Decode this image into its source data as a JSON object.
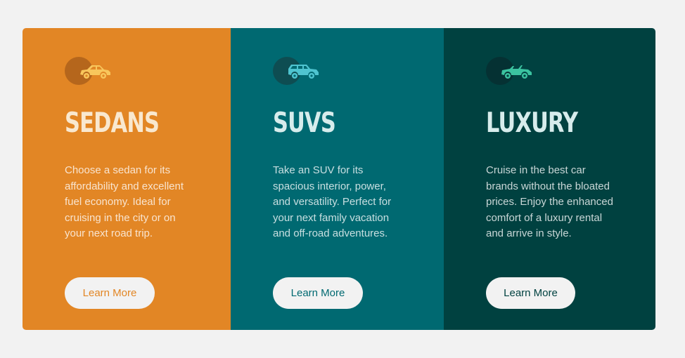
{
  "colors": {
    "page_background": "#f2f2f2",
    "sedans": "#e28625",
    "suvs": "#006971",
    "luxury": "#004140",
    "button_background": "#f2f2f2"
  },
  "cards": [
    {
      "icon": "sedan-car-icon",
      "title": "Sedans",
      "description": "Choose a sedan for its affordability and excellent fuel economy. Ideal for cruising in the city or on your next road trip.",
      "button_label": "Learn More"
    },
    {
      "icon": "suv-car-icon",
      "title": "SUVs",
      "description": "Take an SUV for its spacious interior, power, and versatility. Perfect for your next family vacation and off-road adventures.",
      "button_label": "Learn More"
    },
    {
      "icon": "luxury-car-icon",
      "title": "Luxury",
      "description": "Cruise in the best car brands without the bloated prices. Enjoy the enhanced comfort of a luxury rental and arrive in style.",
      "button_label": "Learn More"
    }
  ]
}
